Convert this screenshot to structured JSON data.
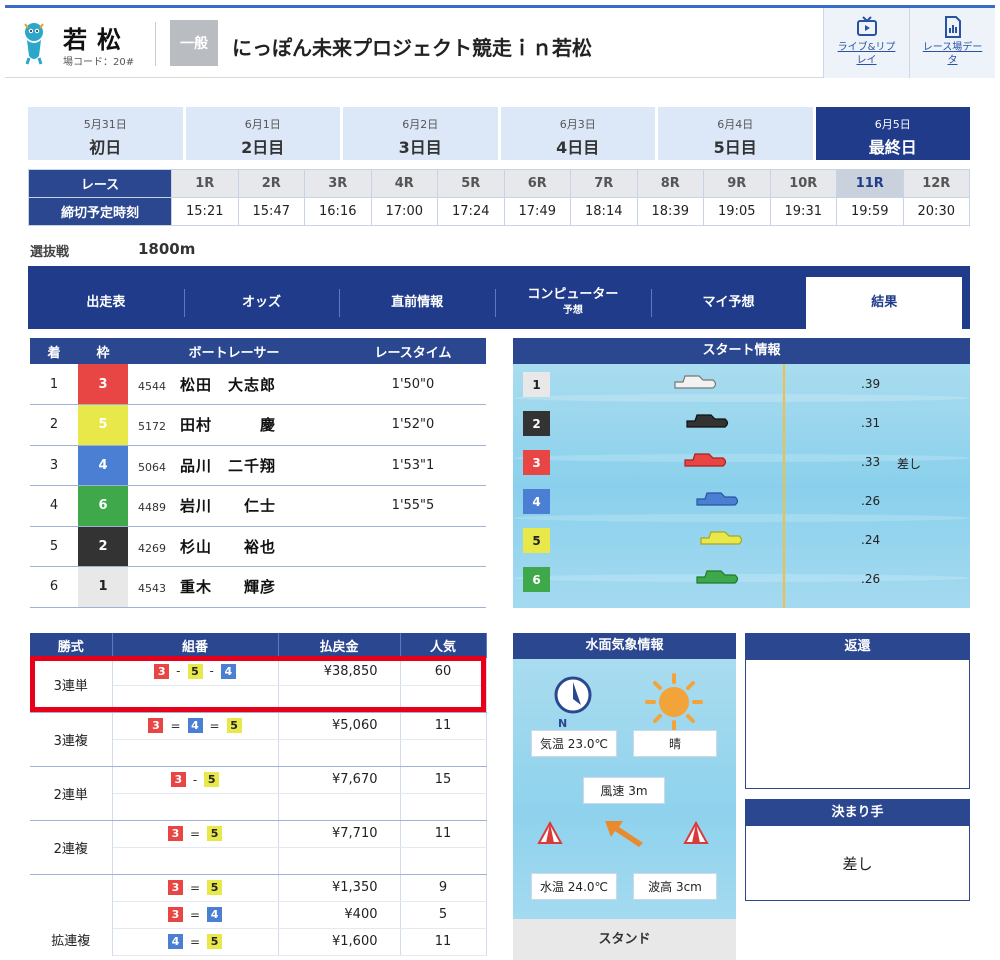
{
  "header": {
    "venue_name": "若松",
    "venue_code": "場コード：20#",
    "grade": "一般",
    "race_title": "にっぽん未来プロジェクト競走ｉｎ若松",
    "links": [
      {
        "label": "ライブ&リプレイ",
        "icon": "tv-play-icon"
      },
      {
        "label": "レース場データ",
        "icon": "chart-document-icon"
      }
    ]
  },
  "days": [
    {
      "date": "5月31日",
      "label": "初日",
      "active": false
    },
    {
      "date": "6月1日",
      "label": "2日目",
      "active": false
    },
    {
      "date": "6月2日",
      "label": "3日目",
      "active": false
    },
    {
      "date": "6月3日",
      "label": "4日目",
      "active": false
    },
    {
      "date": "6月4日",
      "label": "5日目",
      "active": false
    },
    {
      "date": "6月5日",
      "label": "最終日",
      "active": true
    }
  ],
  "race_table": {
    "race_header": "レース",
    "time_header": "締切予定時刻",
    "races": [
      "1R",
      "2R",
      "3R",
      "4R",
      "5R",
      "6R",
      "7R",
      "8R",
      "9R",
      "10R",
      "11R",
      "12R"
    ],
    "times": [
      "15:21",
      "15:47",
      "16:16",
      "17:00",
      "17:24",
      "17:49",
      "18:14",
      "18:39",
      "19:05",
      "19:31",
      "19:59",
      "20:30"
    ],
    "active_race": "11R"
  },
  "race_info": {
    "type": "選抜戦",
    "distance": "1800m"
  },
  "content_tabs": [
    {
      "label": "出走表",
      "sub": ""
    },
    {
      "label": "オッズ",
      "sub": ""
    },
    {
      "label": "直前情報",
      "sub": ""
    },
    {
      "label": "コンピューター",
      "sub": "予想"
    },
    {
      "label": "マイ予想",
      "sub": ""
    },
    {
      "label": "結果",
      "sub": "",
      "active": true
    }
  ],
  "results": {
    "headers": [
      "着",
      "枠",
      "ボートレーサー",
      "レースタイム"
    ],
    "rows": [
      {
        "rank": "1",
        "frame": "3",
        "reg": "4544",
        "name": "松田　大志郎",
        "time": "1'50\"0"
      },
      {
        "rank": "2",
        "frame": "5",
        "reg": "5172",
        "name": "田村　　　慶",
        "time": "1'52\"0"
      },
      {
        "rank": "3",
        "frame": "4",
        "reg": "5064",
        "name": "品川　二千翔",
        "time": "1'53\"1"
      },
      {
        "rank": "4",
        "frame": "6",
        "reg": "4489",
        "name": "岩川　　仁士",
        "time": "1'55\"5"
      },
      {
        "rank": "5",
        "frame": "2",
        "reg": "4269",
        "name": "杉山　　裕也",
        "time": ""
      },
      {
        "rank": "6",
        "frame": "1",
        "reg": "4543",
        "name": "重木　　輝彦",
        "time": ""
      }
    ]
  },
  "start_info": {
    "title": "スタート情報",
    "rows": [
      {
        "lane": "1",
        "st": ".39",
        "tech": ""
      },
      {
        "lane": "2",
        "st": ".31",
        "tech": ""
      },
      {
        "lane": "3",
        "st": ".33",
        "tech": "差し"
      },
      {
        "lane": "4",
        "st": ".26",
        "tech": ""
      },
      {
        "lane": "5",
        "st": ".24",
        "tech": ""
      },
      {
        "lane": "6",
        "st": ".26",
        "tech": ""
      }
    ]
  },
  "payouts": {
    "headers": [
      "勝式",
      "組番",
      "払戻金",
      "人気"
    ],
    "rows": [
      {
        "kind": "3連単",
        "combo": [
          "3",
          "5",
          "4"
        ],
        "ops": [
          "-",
          "-"
        ],
        "amount": "¥38,850",
        "pop": "60"
      },
      {
        "kind": "3連複",
        "combo": [
          "3",
          "4",
          "5"
        ],
        "ops": [
          "=",
          "="
        ],
        "amount": "¥5,060",
        "pop": "11"
      },
      {
        "kind": "2連単",
        "combo": [
          "3",
          "5"
        ],
        "ops": [
          "-"
        ],
        "amount": "¥7,670",
        "pop": "15"
      },
      {
        "kind": "2連複",
        "combo": [
          "3",
          "5"
        ],
        "ops": [
          "="
        ],
        "amount": "¥7,710",
        "pop": "11"
      }
    ],
    "wide": {
      "kind": "拡連複",
      "rows": [
        {
          "combo": [
            "3",
            "5"
          ],
          "ops": [
            "="
          ],
          "amount": "¥1,350",
          "pop": "9"
        },
        {
          "combo": [
            "3",
            "4"
          ],
          "ops": [
            "="
          ],
          "amount": "¥400",
          "pop": "5"
        },
        {
          "combo": [
            "4",
            "5"
          ],
          "ops": [
            "="
          ],
          "amount": "¥1,600",
          "pop": "11"
        }
      ]
    }
  },
  "weather": {
    "title": "水面気象情報",
    "compass_label": "N",
    "temp": "気温 23.0℃",
    "condition": "晴",
    "wind": "風速 3m",
    "water_temp": "水温 24.0℃",
    "wave": "波高 3cm",
    "stand": "スタンド"
  },
  "return_panel": {
    "title": "返還"
  },
  "kimarite": {
    "title": "決まり手",
    "value": "差し"
  },
  "colors": {
    "navy": "#1f3b8a",
    "highlight": "#e8001b",
    "boat1": "#e8e8e8",
    "boat2": "#333333",
    "boat3": "#e84545",
    "boat4": "#4a7fd4",
    "boat5": "#e9e84a",
    "boat6": "#3ea84a"
  }
}
